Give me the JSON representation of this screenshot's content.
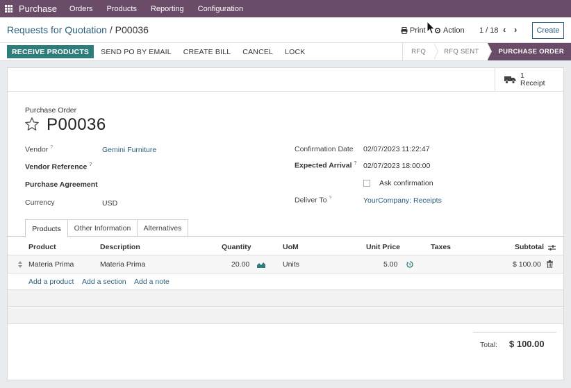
{
  "topbar": {
    "app_name": "Purchase",
    "menu": [
      "Orders",
      "Products",
      "Reporting",
      "Configuration"
    ]
  },
  "control": {
    "breadcrumb_parent": "Requests for Quotation",
    "breadcrumb_sep": "/",
    "breadcrumb_current": "P00036",
    "print_label": "Print",
    "action_label": "Action",
    "pager": "1 / 18",
    "create_label": "Create"
  },
  "statusbar": {
    "primary_button": "RECEIVE PRODUCTS",
    "buttons": [
      "SEND PO BY EMAIL",
      "CREATE BILL",
      "CANCEL",
      "LOCK"
    ],
    "stages": [
      "RFQ",
      "RFQ SENT",
      "PURCHASE ORDER"
    ],
    "active_stage": "PURCHASE ORDER"
  },
  "smart_button": {
    "count": "1",
    "label": "Receipt"
  },
  "form": {
    "title_label": "Purchase Order",
    "name": "P00036",
    "vendor_label": "Vendor",
    "vendor_value": "Gemini Furniture",
    "vendor_ref_label": "Vendor Reference",
    "agreement_label": "Purchase Agreement",
    "currency_label": "Currency",
    "currency_value": "USD",
    "confirm_date_label": "Confirmation Date",
    "confirm_date_value": "02/07/2023 11:22:47",
    "expected_arrival_label": "Expected Arrival",
    "expected_arrival_value": "02/07/2023 18:00:00",
    "ask_confirmation_label": "Ask confirmation",
    "deliver_to_label": "Deliver To",
    "deliver_to_value": "YourCompany: Receipts",
    "help_mark": "?"
  },
  "tabs": [
    "Products",
    "Other Information",
    "Alternatives"
  ],
  "table": {
    "headers": {
      "product": "Product",
      "description": "Description",
      "quantity": "Quantity",
      "uom": "UoM",
      "unit_price": "Unit Price",
      "taxes": "Taxes",
      "subtotal": "Subtotal"
    },
    "rows": [
      {
        "product": "Materia Prima",
        "description": "Materia Prima",
        "quantity": "20.00",
        "uom": "Units",
        "unit_price": "5.00",
        "taxes": "",
        "subtotal": "$ 100.00"
      }
    ],
    "add_links": [
      "Add a product",
      "Add a section",
      "Add a note"
    ]
  },
  "totals": {
    "label": "Total:",
    "value": "$ 100.00"
  },
  "colors": {
    "brand": "#6b4c68",
    "primary_button": "#2e7d7b",
    "link": "#2b5f7d"
  }
}
